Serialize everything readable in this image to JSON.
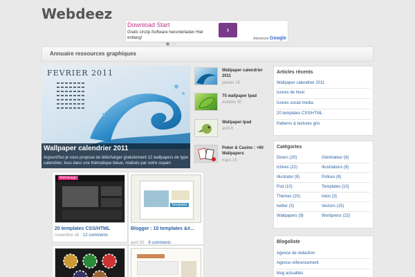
{
  "site": {
    "title": "Webdeez"
  },
  "ad": {
    "headline": "Download Start",
    "body": "Gratis Unzip-Software herunterladen Hier entlang!",
    "brand_prefix": "Annonces",
    "brand_name": "Google",
    "arrow": "›"
  },
  "nav": {
    "label": "Annuaire ressources graphiques"
  },
  "featured": {
    "month": "FEVRIER 2011",
    "title": "Wallpaper calendrier 2011",
    "excerpt": "Aujourd'hui je vous propose de télécharger gratuitement 12 wallpapers de type calendrier, tous dans une thématique bleue, réalisés par notre copain"
  },
  "side_posts": [
    {
      "title": "Wallpaper calendrier 2011",
      "date": "janvier 15"
    },
    {
      "title": "75 wallpaper Ipad",
      "date": "octobre 30"
    },
    {
      "title": "Wallpaper Ipad",
      "date": "avril 8"
    },
    {
      "title": "Poker & Casino : +60 Wallpapers",
      "date": "mars 15"
    }
  ],
  "grid_posts": [
    {
      "title": "20 templates CSS/HTML",
      "date": "novembre 16",
      "comments": "12 comments",
      "thumb_label": "Webdesign"
    },
    {
      "title": "Blogger : 10 templates &#...",
      "date": "avril 30",
      "comments": "8 comments",
      "thumb_label": "Templates"
    }
  ],
  "widgets": {
    "recent": {
      "title": "Articles récents",
      "items": [
        "Wallpaper calendrier 2011",
        "Icones de Noel",
        "Icones social media",
        "20 templates CSS/HTML",
        "Patterns & textures gris"
      ]
    },
    "categories": {
      "title": "Catégories",
      "items": [
        [
          "Divers (20)",
          "Générateur (8)"
        ],
        [
          "Icônes (22)",
          "Illustrations (8)"
        ],
        [
          "illustrator (8)",
          "Polices (8)"
        ],
        [
          "Psd (10)",
          "Templates (10)"
        ],
        [
          "Thèmes (20)",
          "tutos (3)"
        ],
        [
          "twitter (3)",
          "Vectors (15)"
        ],
        [
          "Wallpapers (9)",
          "Wordpress (22)"
        ]
      ]
    },
    "blogroll": {
      "title": "Blogoliste",
      "items": [
        "Agence de rédaction",
        "Agence référencement",
        "blog actualités"
      ]
    }
  }
}
